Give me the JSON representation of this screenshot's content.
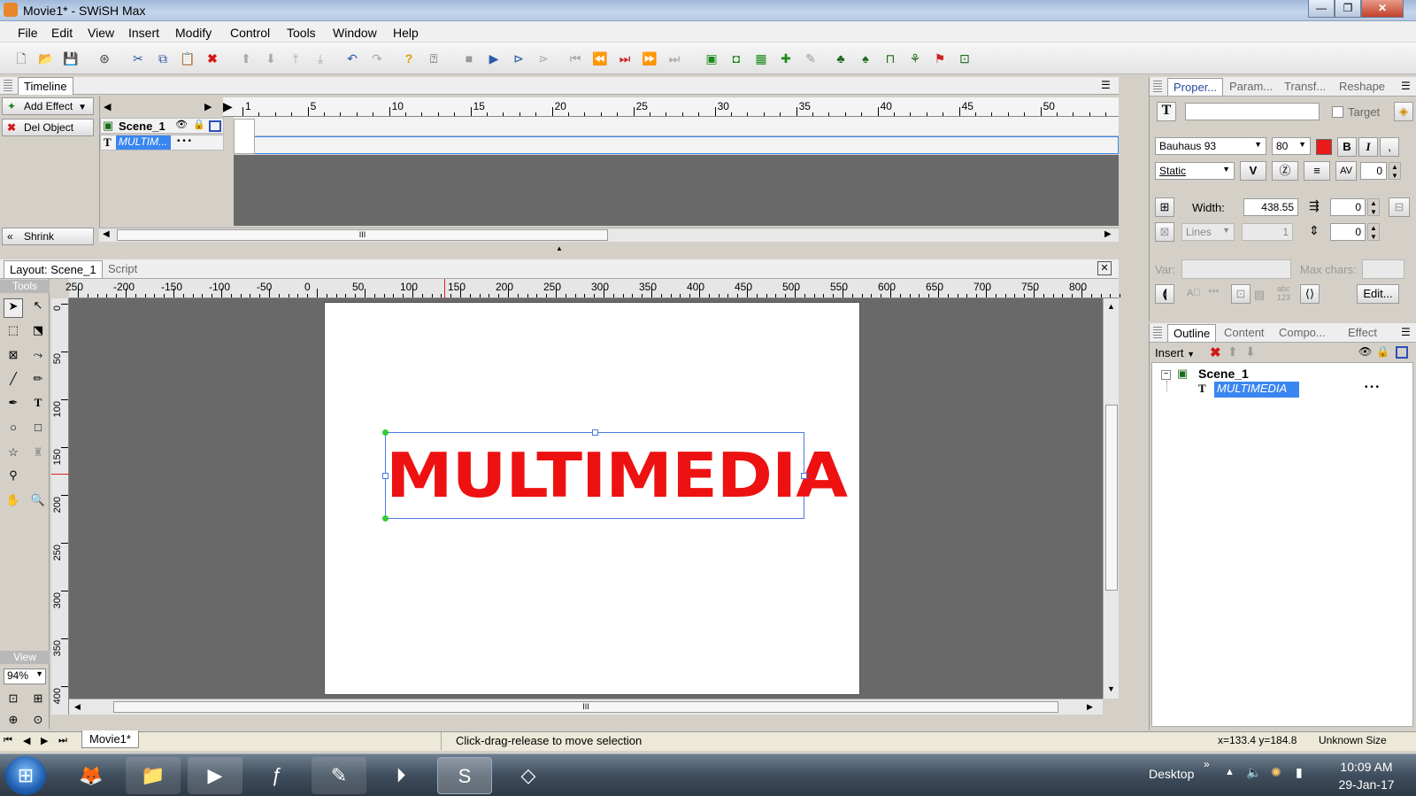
{
  "window": {
    "title": "Movie1* - SWiSH Max",
    "minimize": "—",
    "maximize": "❐",
    "close": "✕"
  },
  "menu": [
    "File",
    "Edit",
    "View",
    "Insert",
    "Modify",
    "Control",
    "Tools",
    "Window",
    "Help"
  ],
  "toolbar": {
    "icons": [
      "new-icon",
      "open-icon",
      "save-icon",
      "print-preview-icon",
      "cut-icon",
      "copy-icon",
      "paste-icon",
      "delete-icon",
      "bring-forward-icon",
      "send-backward-icon",
      "bring-to-front-icon",
      "send-to-back-icon",
      "undo-icon",
      "redo-icon",
      "help-icon",
      "context-help-icon",
      "stop-icon",
      "play-icon",
      "play-timeline-icon",
      "play-effect-icon",
      "first-frame-icon",
      "prev-frame-icon",
      "next-keyframe-icon",
      "next-frame-icon",
      "last-frame-icon",
      "insert-scene-icon",
      "insert-button-icon",
      "insert-group-icon",
      "insert-sprite-icon",
      "insert-script-icon",
      "insert-sound-icon",
      "export-swf-icon",
      "export-html-icon",
      "export-exe-icon",
      "export-flash-icon",
      "test-icon"
    ]
  },
  "timeline": {
    "tab": "Timeline",
    "add_effect": "Add Effect",
    "del_object": "Del Object",
    "shrink": "Shrink",
    "ruler_labels": [
      "1",
      "5",
      "10",
      "15",
      "20",
      "25",
      "30",
      "35",
      "40",
      "45",
      "50"
    ],
    "rows": [
      {
        "label": "Scene_1"
      },
      {
        "label": "MULTIM...",
        "dots": "•   •   •"
      }
    ],
    "scroll_glyph": "III"
  },
  "layout": {
    "tab_layout": "Layout: Scene_1",
    "tab_script": "Script",
    "tools_label": "Tools",
    "view_label": "View",
    "zoom": "94%",
    "h_ruler": [
      "250",
      "-200",
      "-150",
      "-100",
      "-50",
      "0",
      "50",
      "100",
      "150",
      "200",
      "250",
      "300",
      "350",
      "400",
      "450",
      "500",
      "550",
      "600",
      "650",
      "700",
      "750",
      "800"
    ],
    "v_ruler": [
      "0",
      "50",
      "100",
      "150",
      "200",
      "250",
      "300",
      "350",
      "400"
    ],
    "stage_text": "MULTIMEDIA",
    "stage_text_color": "#ee1111"
  },
  "properties": {
    "tabs": [
      "Proper...",
      "Param...",
      "Transf...",
      "Reshape"
    ],
    "target_label": "Target",
    "font": "Bauhaus 93",
    "size": "80",
    "bold": "B",
    "italic": "I",
    "text_type": "Static",
    "kerning": "0",
    "width_label": "Width:",
    "width_value": "438.55",
    "indent_value": "0",
    "lines_placeholder": "Lines",
    "lines_value": "1",
    "spacing_value": "0",
    "var_label": "Var:",
    "max_chars_label": "Max chars:",
    "edit_button": "Edit...",
    "abc_label": "abc 123"
  },
  "outline": {
    "tabs": [
      "Outline",
      "Content",
      "Compo...",
      "Effect"
    ],
    "insert_label": "Insert",
    "tree": [
      {
        "label": "Scene_1"
      },
      {
        "label": "MULTIMEDIA",
        "dots": "•   •   •"
      }
    ]
  },
  "statusbar": {
    "doc_tab": "Movie1*",
    "message": "Click-drag-release to move selection",
    "coords": "x=133.4 y=184.8",
    "size": "Unknown Size"
  },
  "taskbar": {
    "desktop": "Desktop",
    "time": "10:09 AM",
    "date": "29-Jan-17"
  }
}
